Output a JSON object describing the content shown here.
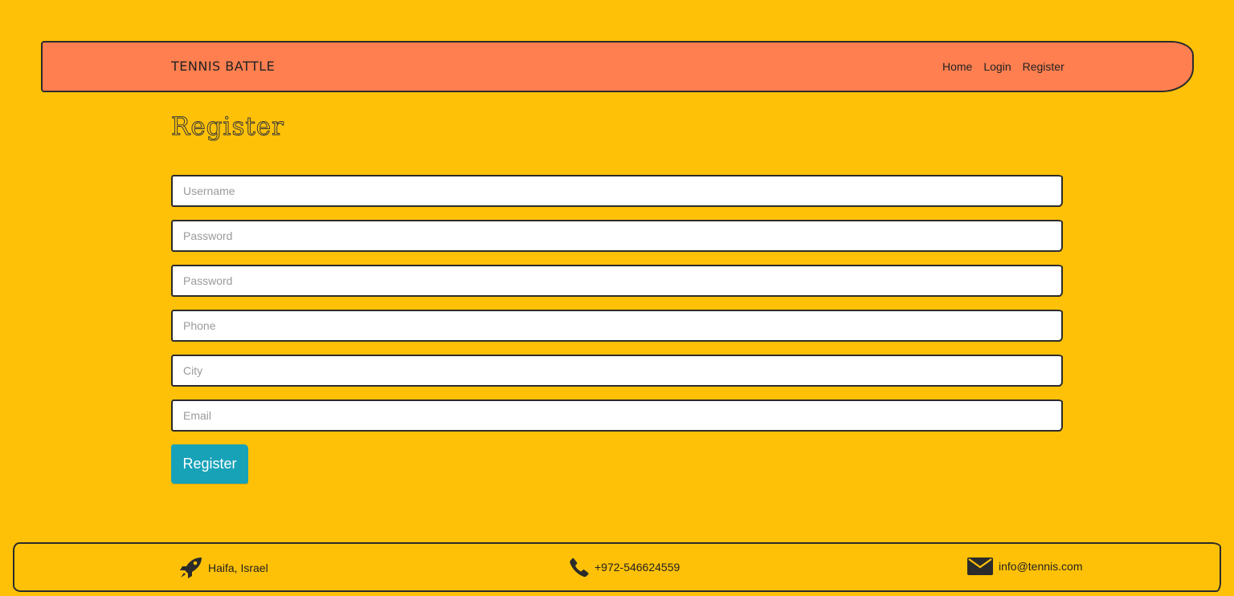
{
  "navbar": {
    "brand": "Tennis Battle",
    "links": [
      "Home",
      "Login",
      "Register"
    ]
  },
  "page": {
    "title": "Register"
  },
  "form": {
    "fields": [
      {
        "placeholder": "Username",
        "value": ""
      },
      {
        "placeholder": "Password",
        "value": ""
      },
      {
        "placeholder": "Password",
        "value": ""
      },
      {
        "placeholder": "Phone",
        "value": ""
      },
      {
        "placeholder": "City",
        "value": ""
      },
      {
        "placeholder": "Email",
        "value": ""
      }
    ],
    "submit_label": "Register"
  },
  "footer": {
    "location": {
      "icon": "rocket-icon",
      "text": "Haifa, Israel"
    },
    "phone": {
      "icon": "phone-icon",
      "text": "+972-546624559"
    },
    "email": {
      "icon": "envelope-icon",
      "text": "info@tennis.com"
    }
  },
  "colors": {
    "background": "#FFC107",
    "navbar": "#FF7F50",
    "button": "#17A2B8",
    "border": "#2b2b2b"
  }
}
